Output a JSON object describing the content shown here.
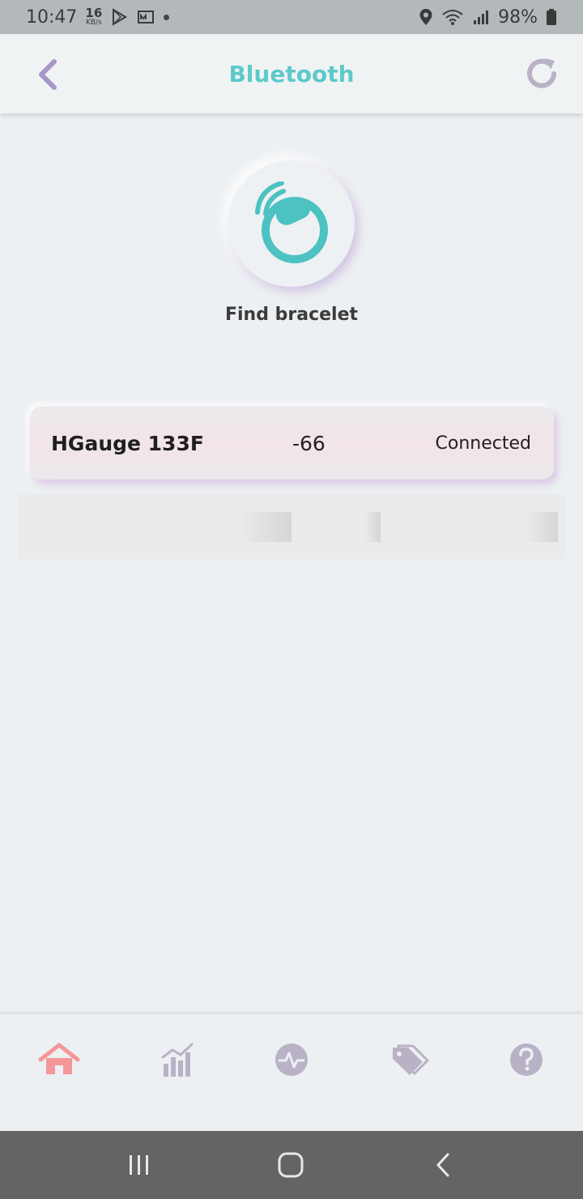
{
  "status_bar": {
    "time": "10:47",
    "net_speed_value": "16",
    "net_speed_unit": "KB/s",
    "battery": "98%"
  },
  "header": {
    "title": "Bluetooth",
    "back_icon": "chevron-left-icon",
    "refresh_icon": "refresh-icon"
  },
  "find": {
    "label": "Find bracelet",
    "icon": "bracelet-signal-icon"
  },
  "devices": [
    {
      "name": "HGauge 133F",
      "rssi": "-66",
      "status": "Connected"
    }
  ],
  "bottom_nav": {
    "items": [
      {
        "icon": "home-icon",
        "active": true
      },
      {
        "icon": "bar-chart-icon",
        "active": false
      },
      {
        "icon": "heartbeat-icon",
        "active": false
      },
      {
        "icon": "tags-icon",
        "active": false
      },
      {
        "icon": "help-icon",
        "active": false
      }
    ]
  },
  "colors": {
    "accent": "#5ec9c9",
    "icon_inactive": "#b9b2c6",
    "icon_active": "#f59698",
    "background": "#edf0f2"
  }
}
